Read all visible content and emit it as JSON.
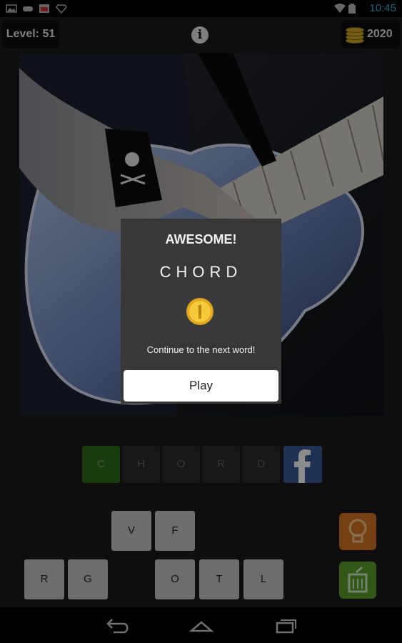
{
  "status": {
    "time": "10:45"
  },
  "header": {
    "level_text": "Level: 51",
    "coins": "2020"
  },
  "answer": {
    "letters": [
      "C",
      "H",
      "O",
      "R",
      "D"
    ]
  },
  "keyboard": {
    "row1": [
      "V",
      "F"
    ],
    "row2": [
      "R",
      "G",
      "O",
      "T",
      "L"
    ]
  },
  "dialog": {
    "title": "AWESOME!",
    "word": "CHORD",
    "message": "Continue to the next word!",
    "play_label": "Play"
  },
  "colors": {
    "status_clock": "#33b5e5",
    "correct_slot": "#2f6b17",
    "facebook": "#3b5998",
    "hint": "#d67623",
    "remove": "#5b9f2b"
  },
  "icons": [
    "gallery-icon",
    "game-controller-icon",
    "calendar-icon",
    "diamond-icon",
    "wifi-icon",
    "battery-icon",
    "info-icon",
    "coins-icon",
    "facebook-icon",
    "lightbulb-icon",
    "trash-icon",
    "back-icon",
    "home-icon",
    "recent-apps-icon"
  ]
}
